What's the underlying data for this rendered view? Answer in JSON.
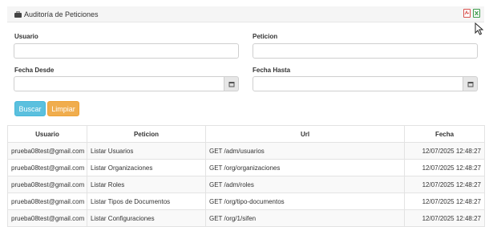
{
  "panel": {
    "title": "Auditoría de Peticiones",
    "pdf_icon": "pdf-file-icon",
    "excel_icon": "excel-file-icon"
  },
  "form": {
    "usuario": {
      "label": "Usuario",
      "value": ""
    },
    "peticion": {
      "label": "Peticion",
      "value": ""
    },
    "fecha_desde": {
      "label": "Fecha Desde",
      "value": ""
    },
    "fecha_hasta": {
      "label": "Fecha Hasta",
      "value": ""
    }
  },
  "buttons": {
    "search_label": "Buscar",
    "clear_label": "Limpiar"
  },
  "colors": {
    "search": "#5bc0de",
    "clear": "#f0ad4e",
    "pdf": "#d9534f",
    "excel": "#3c9a4a"
  },
  "table": {
    "headers": [
      "Usuario",
      "Peticion",
      "Url",
      "Fecha"
    ],
    "rows": [
      [
        "prueba08test@gmail.com",
        "Listar Usuarios",
        "GET /adm/usuarios",
        "12/07/2025 12:48:27"
      ],
      [
        "prueba08test@gmail.com",
        "Listar Organizaciones",
        "GET /org/organizaciones",
        "12/07/2025 12:48:27"
      ],
      [
        "prueba08test@gmail.com",
        "Listar Roles",
        "GET /adm/roles",
        "12/07/2025 12:48:27"
      ],
      [
        "prueba08test@gmail.com",
        "Listar Tipos de Documentos",
        "GET /org/tipo-documentos",
        "12/07/2025 12:48:27"
      ],
      [
        "prueba08test@gmail.com",
        "Listar Configuraciones",
        "GET /org/1/sifen",
        "12/07/2025 12:48:27"
      ]
    ]
  }
}
